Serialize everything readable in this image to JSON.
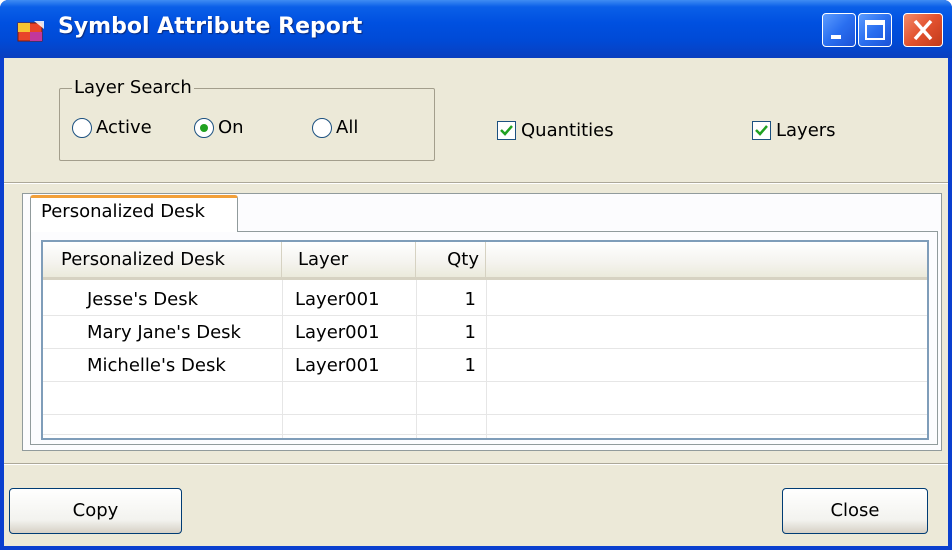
{
  "window": {
    "title": "Symbol Attribute Report"
  },
  "layer_search": {
    "title": "Layer Search",
    "options": [
      {
        "label": "Active",
        "checked": false
      },
      {
        "label": "On",
        "checked": true
      },
      {
        "label": "All",
        "checked": false
      }
    ]
  },
  "checkboxes": {
    "quantities": {
      "label": "Quantities",
      "checked": true
    },
    "layers": {
      "label": "Layers",
      "checked": true
    }
  },
  "tabs": [
    {
      "label": "Personalized Desk",
      "active": true
    }
  ],
  "table": {
    "columns": [
      "Personalized Desk",
      "Layer",
      "Qty"
    ],
    "rows": [
      [
        "Jesse's Desk",
        "Layer001",
        "1"
      ],
      [
        "Mary Jane's Desk",
        "Layer001",
        "1"
      ],
      [
        "Michelle's Desk",
        "Layer001",
        "1"
      ]
    ]
  },
  "buttons": {
    "copy": "Copy",
    "close": "Close"
  },
  "colors": {
    "titlebar": "#0054e3",
    "client": "#ece9d8",
    "tab_accent": "#f2a03a",
    "check": "#21a121"
  }
}
